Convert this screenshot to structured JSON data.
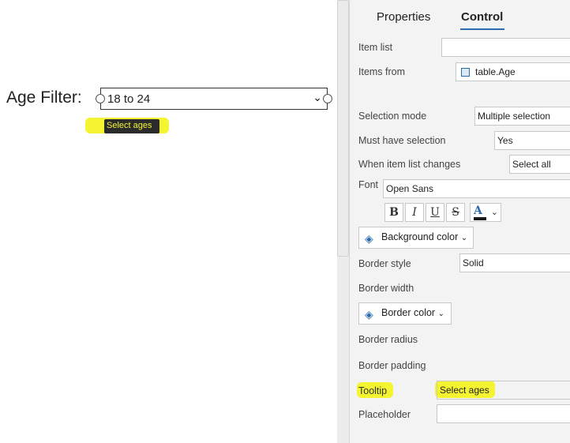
{
  "canvas": {
    "filter_label": "Age Filter:",
    "dropdown_value": "18 to 24",
    "tooltip": "Select ages"
  },
  "panel": {
    "tabs": [
      {
        "label": "Properties",
        "active": false
      },
      {
        "label": "Control",
        "active": true
      }
    ],
    "item_list_label": "Item list",
    "item_list_value": "",
    "items_from_label": "Items from",
    "items_from_value": "table.Age",
    "selection_mode_label": "Selection mode",
    "selection_mode_value": "Multiple selection",
    "must_have_selection_label": "Must have selection",
    "must_have_selection_value": "Yes",
    "item_list_changes_label": "When item list changes",
    "item_list_changes_value": "Select all",
    "font_label": "Font",
    "font_value": "Open Sans",
    "format_buttons": [
      "B",
      "I",
      "U",
      "S",
      "A"
    ],
    "background_color_label": "Background color",
    "border_style_label": "Border style",
    "border_style_value": "Solid",
    "border_width_label": "Border width",
    "border_color_label": "Border color",
    "border_radius_label": "Border radius",
    "border_padding_label": "Border padding",
    "tooltip_label": "Tooltip",
    "tooltip_value": "Select ages",
    "placeholder_label": "Placeholder",
    "placeholder_value": ""
  },
  "colors": {
    "accent": "#2b6cb0",
    "highlight": "#f4f431",
    "font_color_bar": "#1a1a1a"
  }
}
